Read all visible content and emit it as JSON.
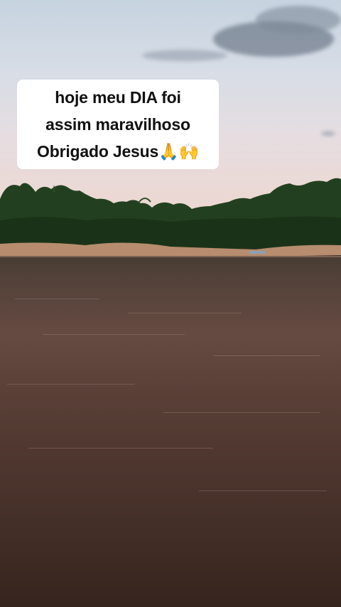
{
  "caption": {
    "line1": "hoje meu DIA foi",
    "line2": "assim maravilhoso",
    "line3": "Obrigado Jesus🙏🙌"
  },
  "colors": {
    "sky_top": "#c6d3e0",
    "sky_horizon": "#edd7d0",
    "trees": "#1f3a1c",
    "river": "#5c4239",
    "caption_bg": "#ffffff",
    "caption_text": "#111111"
  }
}
